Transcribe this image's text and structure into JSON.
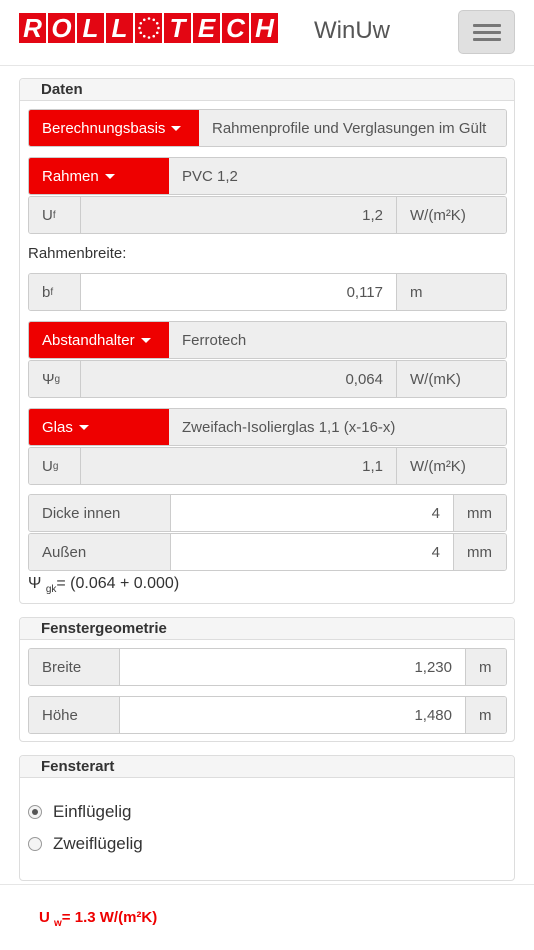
{
  "brand": {
    "logo_letters": [
      "R",
      "O",
      "L",
      "L",
      "T",
      "E",
      "C",
      "H"
    ],
    "app_name": "WinUw",
    "accent_color": "#ee0000"
  },
  "menu": {
    "icon": "hamburger-menu-icon"
  },
  "daten": {
    "title": "Daten",
    "berechnungsbasis": {
      "label": "Berechnungsbasis",
      "value": "Rahmenprofile und Verglasungen im Gült"
    },
    "rahmen": {
      "label": "Rahmen",
      "value": "PVC 1,2"
    },
    "uf": {
      "symbol": "U",
      "sub": "f",
      "value": "1,2",
      "unit": "W/(m²K)"
    },
    "rahmenbreite_label": "Rahmenbreite:",
    "bf": {
      "symbol": "b",
      "sub": "f",
      "value": "0,117",
      "unit": "m"
    },
    "abstandhalter": {
      "label": "Abstandhalter",
      "value": "Ferrotech"
    },
    "psi_g": {
      "symbol": "Ψ",
      "sub": "g",
      "value": "0,064",
      "unit": "W/(mK)"
    },
    "glas": {
      "label": "Glas",
      "value": "Zweifach-Isolierglas 1,1 (x-16-x)"
    },
    "ug": {
      "symbol": "U",
      "sub": "g",
      "value": "1,1",
      "unit": "W/(m²K)"
    },
    "dicke_innen": {
      "label": "Dicke innen",
      "value": "4",
      "unit": "mm"
    },
    "aussen": {
      "label": "Außen",
      "value": "4",
      "unit": "mm"
    },
    "formula": {
      "symbol": "Ψ",
      "sub": "gk",
      "text": "= (0.064 + 0.000)"
    }
  },
  "geometrie": {
    "title": "Fenstergeometrie",
    "breite": {
      "label": "Breite",
      "value": "1,230",
      "unit": "m"
    },
    "hoehe": {
      "label": "Höhe",
      "value": "1,480",
      "unit": "m"
    }
  },
  "fensterart": {
    "title": "Fensterart",
    "options": [
      {
        "label": "Einflügelig",
        "checked": true
      },
      {
        "label": "Zweiflügelig",
        "checked": false
      }
    ]
  },
  "result": {
    "symbol": "U",
    "sub": "w",
    "text": "= 1.3 W/(m²K)"
  }
}
